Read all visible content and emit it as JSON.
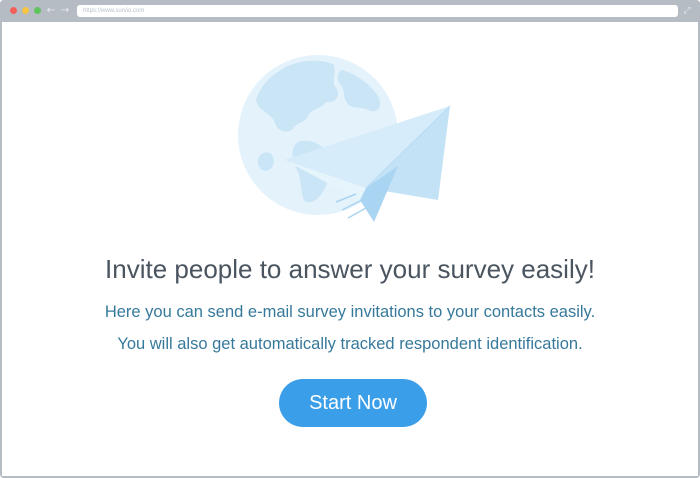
{
  "browser": {
    "url": "https://www.survio.com",
    "back_icon": "arrow-left-icon",
    "forward_icon": "arrow-right-icon",
    "expand_icon": "expand-icon",
    "back_glyph": "←",
    "forward_glyph": "→",
    "expand_glyph": "⤢"
  },
  "illustration": {
    "description_icon": "globe-paper-plane-illustration"
  },
  "main": {
    "headline": "Invite people to answer your survey easily!",
    "description_line1": "Here you can send e-mail survey invitations to your contacts easily.",
    "description_line2": "You will also get automatically tracked respondent identification.",
    "cta_label": "Start Now"
  },
  "colors": {
    "accent": "#3b9ee8",
    "headline": "#4a5560",
    "description": "#36799b",
    "frame": "#b5bcc4"
  }
}
